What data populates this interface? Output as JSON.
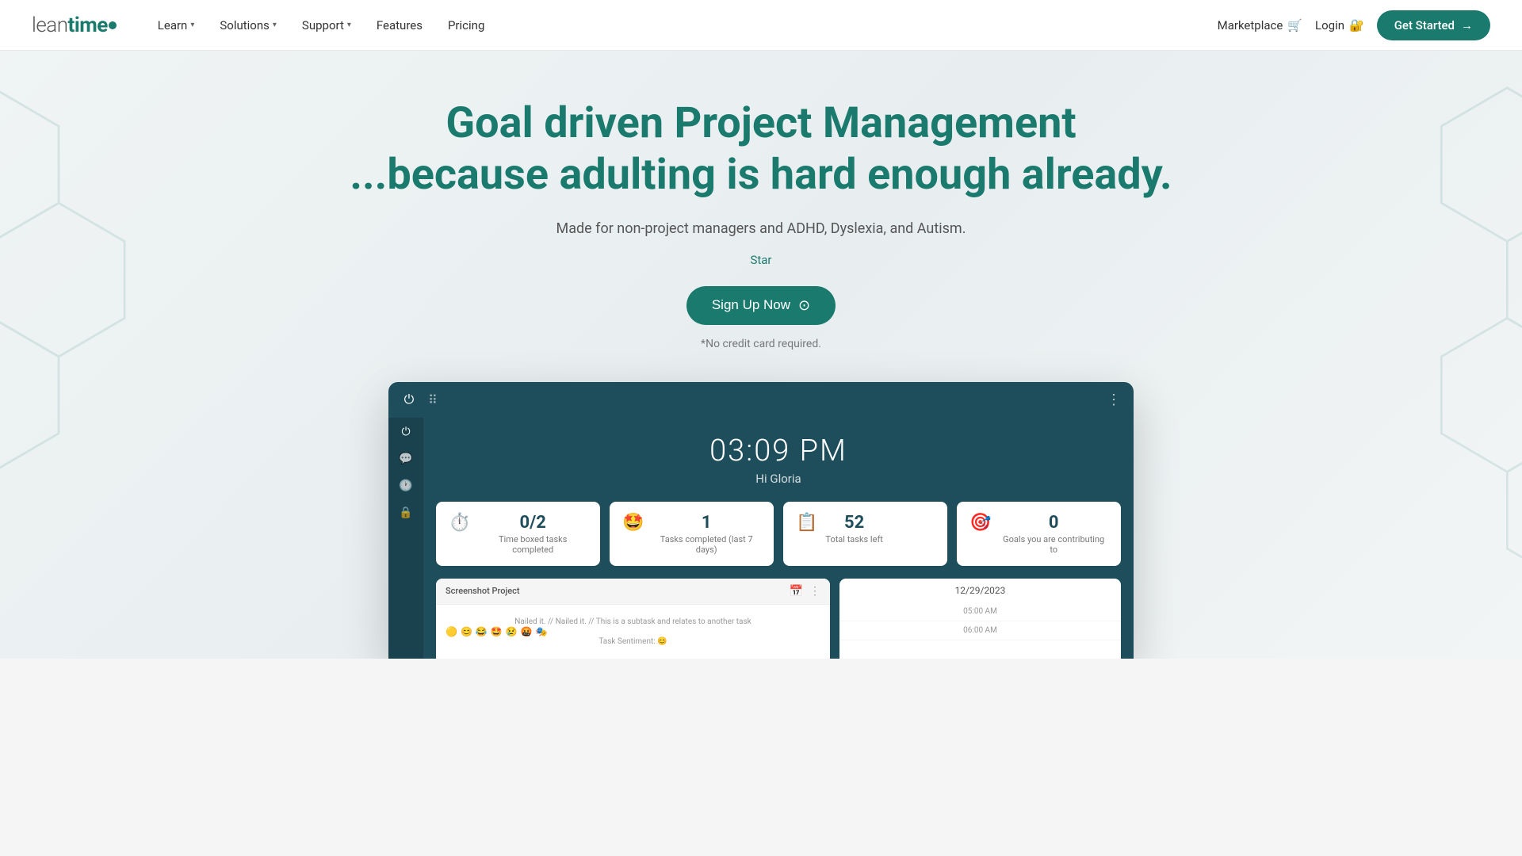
{
  "nav": {
    "logo_lean": "lean",
    "logo_time": "time",
    "links": [
      {
        "label": "Learn",
        "hasDropdown": true
      },
      {
        "label": "Solutions",
        "hasDropdown": true
      },
      {
        "label": "Support",
        "hasDropdown": true
      },
      {
        "label": "Features",
        "hasDropdown": false
      },
      {
        "label": "Pricing",
        "hasDropdown": false
      }
    ],
    "marketplace_label": "Marketplace",
    "login_label": "Login",
    "get_started_label": "Get Started"
  },
  "hero": {
    "title_line1": "Goal driven Project Management",
    "title_line2": "...because adulting is hard enough already.",
    "subtitle": "Made for non-project managers and ADHD, Dyslexia, and Autism.",
    "star_label": "Star",
    "signup_button": "Sign Up Now",
    "no_credit_card": "*No credit card required."
  },
  "app": {
    "time": "03:09 PM",
    "greeting": "Hi Gloria",
    "stats": [
      {
        "emoji": "⏱️",
        "value": "0/2",
        "label": "Time boxed tasks completed"
      },
      {
        "emoji": "🤩",
        "value": "1",
        "label": "Tasks completed (last 7 days)"
      },
      {
        "emoji": "📋",
        "value": "52",
        "label": "Total tasks left"
      },
      {
        "emoji": "🎯",
        "value": "0",
        "label": "Goals you are contributing to"
      }
    ],
    "panel_left": {
      "project": "Screenshot Project",
      "task_text": "Nailed it. // This is a subtask and relates to another task",
      "sentiment_label": "Task Sentiment:",
      "sentiment_emoji": "😊"
    },
    "panel_right": {
      "date": "12/29/2023",
      "time_slots": [
        "05:00 AM",
        "06:00 AM"
      ]
    }
  },
  "icons": {
    "power": "⏻",
    "grid": "⠿",
    "comment": "💬",
    "clock": "🕐",
    "lock": "🔒",
    "cart": "🛒",
    "login_lock": "🔐",
    "arrow_right": "→",
    "dots_vertical": "⋮",
    "calendar_icon": "📅",
    "more_icon": "⋮"
  }
}
